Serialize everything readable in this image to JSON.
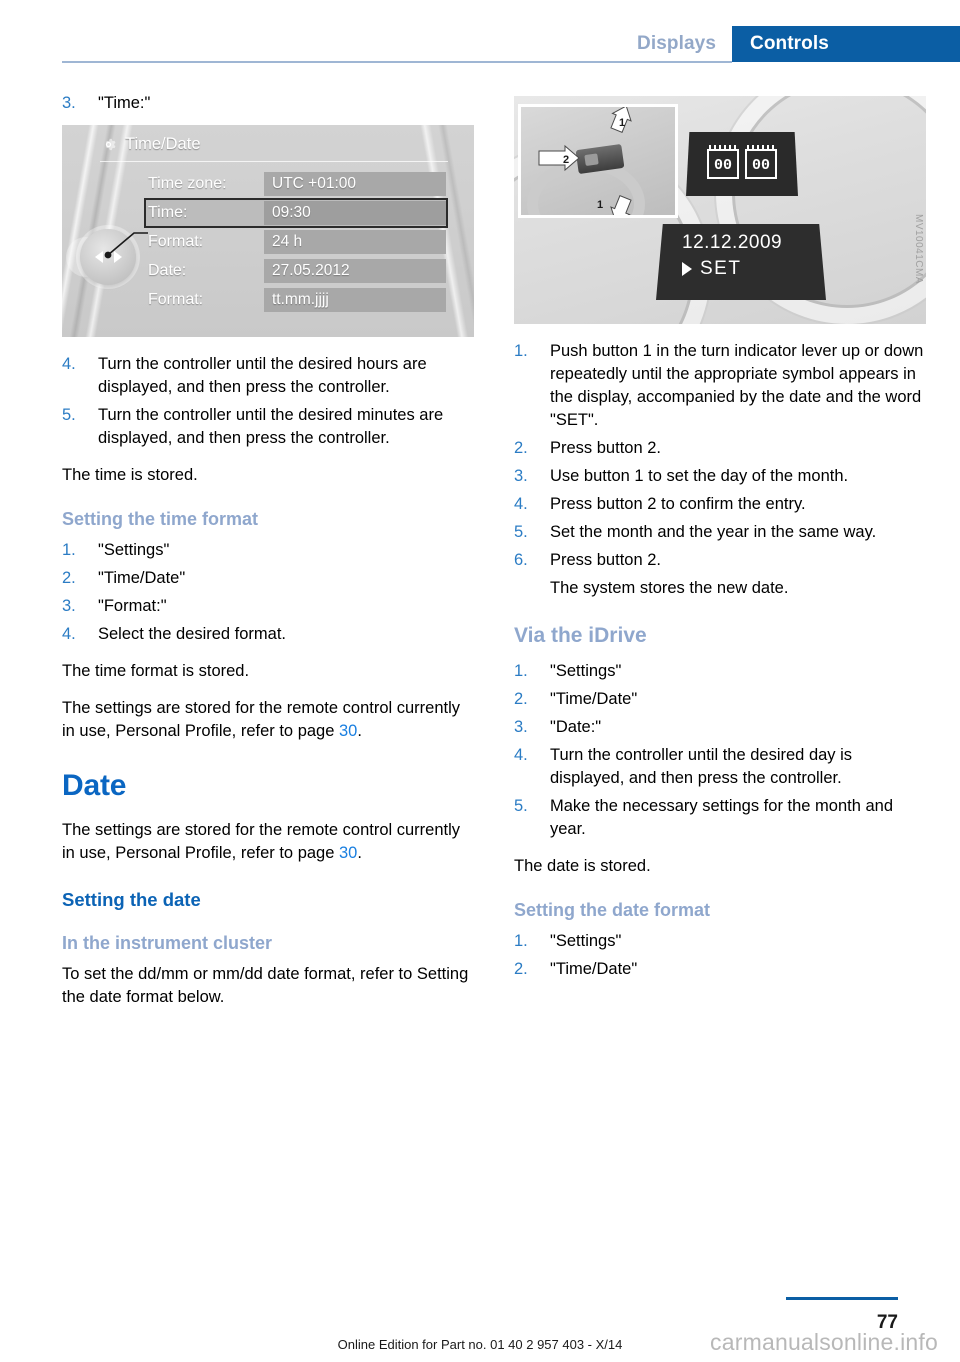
{
  "header": {
    "tab_inactive": "Displays",
    "tab_active": "Controls",
    "accent_blue": "#0b5ea4"
  },
  "left_column": {
    "step3": {
      "num": "3.",
      "text": "\"Time:\""
    },
    "idrive_figure": {
      "title": "Time/Date",
      "gear_icon": "gear-icon",
      "rows": [
        {
          "label": "Time zone:",
          "value": "UTC +01:00",
          "selected": false
        },
        {
          "label": "Time:",
          "value": "09:30",
          "selected": true
        },
        {
          "label": "Format:",
          "value": "24 h",
          "selected": false
        },
        {
          "label": "Date:",
          "value": "27.05.2012",
          "selected": false
        },
        {
          "label": "Format:",
          "value": "tt.mm.jjjj",
          "selected": false
        }
      ]
    },
    "steps_45": [
      {
        "num": "4.",
        "text": "Turn the controller until the desired hours are displayed, and then press the controller."
      },
      {
        "num": "5.",
        "text": "Turn the controller until the desired minutes are displayed, and then press the controller."
      }
    ],
    "time_stored": "The time is stored.",
    "heading_time_format": "Setting the time format",
    "time_format_steps": [
      {
        "num": "1.",
        "text": "\"Settings\""
      },
      {
        "num": "2.",
        "text": "\"Time/Date\""
      },
      {
        "num": "3.",
        "text": "\"Format:\""
      },
      {
        "num": "4.",
        "text": "Select the desired format."
      }
    ],
    "time_format_stored": "The time format is stored.",
    "remote_note_pre": "The settings are stored for the remote control currently in use, Personal Profile, refer to page ",
    "remote_note_link": "30",
    "remote_note_post": ".",
    "heading_date": "Date",
    "remote_note2_pre": "The settings are stored for the remote control currently in use, Personal Profile, refer to page ",
    "remote_note2_link": "30",
    "remote_note2_post": ".",
    "heading_setting_date": "Setting the date",
    "heading_instrument_cluster": "In the instrument cluster",
    "instrument_cluster_text": "To set the dd/mm or mm/dd date format, refer to Setting the date format below."
  },
  "right_column": {
    "cluster_figure": {
      "label_1_top": "1",
      "label_2": "2",
      "label_1_bottom": "1",
      "display_digits_left": "00",
      "display_digits_right": "00",
      "display_date": "12.12.2009",
      "display_set": "SET",
      "figure_code": "MV10041CMA"
    },
    "cluster_steps": [
      {
        "num": "1.",
        "text": "Push button 1 in the turn indicator lever up or down repeatedly until the appropriate symbol appears in the display, accompanied by the date and the word \"SET\"."
      },
      {
        "num": "2.",
        "text": "Press button 2."
      },
      {
        "num": "3.",
        "text": "Use button 1 to set the day of the month."
      },
      {
        "num": "4.",
        "text": "Press button 2 to confirm the entry."
      },
      {
        "num": "5.",
        "text": "Set the month and the year in the same way."
      },
      {
        "num": "6.",
        "text": "Press button 2.",
        "sub": "The system stores the new date."
      }
    ],
    "heading_via_idrive": "Via the iDrive",
    "idrive_steps": [
      {
        "num": "1.",
        "text": "\"Settings\""
      },
      {
        "num": "2.",
        "text": "\"Time/Date\""
      },
      {
        "num": "3.",
        "text": "\"Date:\""
      },
      {
        "num": "4.",
        "text": "Turn the controller until the desired day is displayed, and then press the controller."
      },
      {
        "num": "5.",
        "text": "Make the necessary settings for the month and year."
      }
    ],
    "date_stored": "The date is stored.",
    "heading_date_format": "Setting the date format",
    "date_format_steps": [
      {
        "num": "1.",
        "text": "\"Settings\""
      },
      {
        "num": "2.",
        "text": "\"Time/Date\""
      }
    ]
  },
  "footer": {
    "edition": "Online Edition for Part no. 01 40 2 957 403 - X/14",
    "page_number": "77",
    "watermark": "carmanualsonline.info"
  }
}
